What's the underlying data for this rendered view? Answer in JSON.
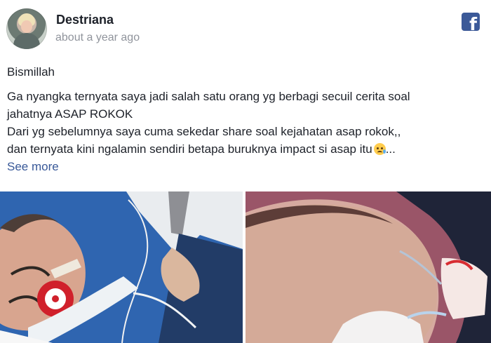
{
  "post": {
    "author": "Destriana",
    "timestamp": "about a year ago",
    "platform_icon": "facebook-icon",
    "text_line_1": "Bismillah",
    "text_line_2": "Ga nyangka ternyata saya jadi salah satu orang yg berbagi secuil cerita soal",
    "text_line_3": "jahatnya ASAP ROKOK",
    "text_line_4": "Dari yg sebelumnya saya cuma sekedar share soal kejahatan asap rokok,,",
    "text_line_5": "dan ternyata kini ngalamin sendiri betapa buruknya impact si asap itu",
    "ellipsis": "...",
    "see_more": "See more",
    "emoji_name": "sad-face-emoji"
  },
  "colors": {
    "facebook_blue": "#3b5998",
    "link": "#385898",
    "timestamp": "#90949c"
  }
}
